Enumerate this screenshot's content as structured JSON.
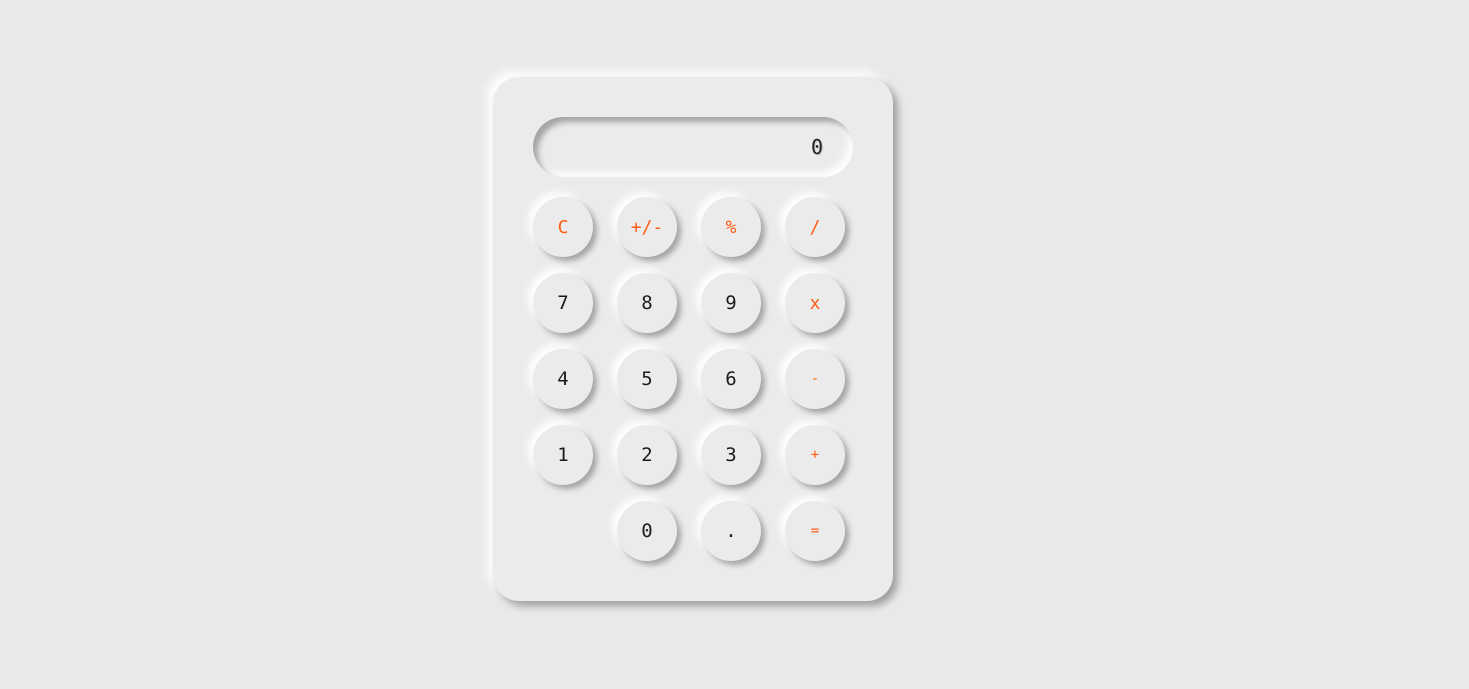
{
  "display": {
    "value": "0"
  },
  "keys": {
    "clear": "C",
    "sign": "+/-",
    "percent": "%",
    "divide": "/",
    "seven": "7",
    "eight": "8",
    "nine": "9",
    "multiply": "x",
    "four": "4",
    "five": "5",
    "six": "6",
    "subtract": "-",
    "one": "1",
    "two": "2",
    "three": "3",
    "add": "+",
    "zero": "0",
    "decimal": ".",
    "equals": "="
  },
  "colors": {
    "background": "#e9e9e9",
    "operator": "#ff5d14",
    "digit": "#1c1c1c"
  }
}
